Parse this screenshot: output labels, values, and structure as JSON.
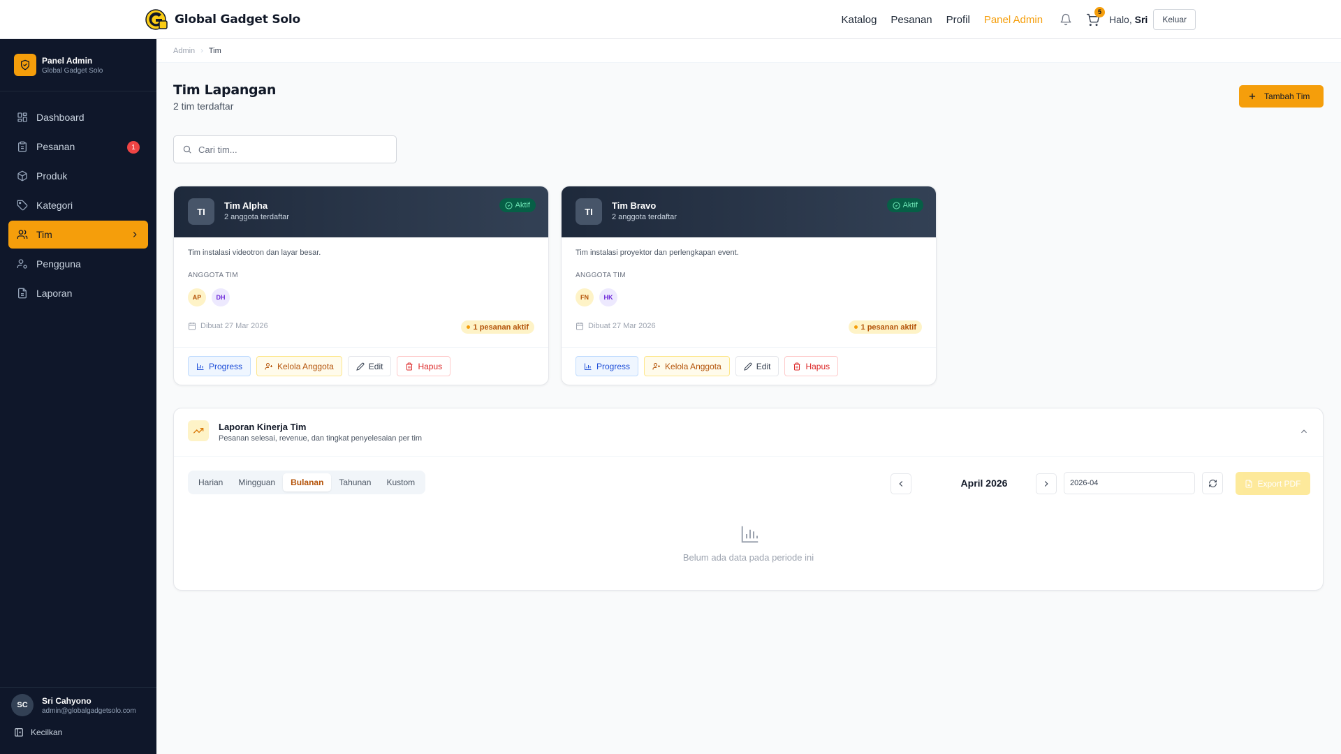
{
  "app": {
    "name": "Global Gadget Solo",
    "accent": "#f59e0b"
  },
  "topnav": {
    "links": [
      "Katalog",
      "Pesanan",
      "Profil",
      "Panel Admin"
    ],
    "active": "Panel Admin",
    "cart_count": "5",
    "greeting_prefix": "Halo,",
    "user_first_name": "Sri",
    "logout_label": "Keluar"
  },
  "sidebar": {
    "title": "Panel Admin",
    "subtitle": "Global Gadget Solo",
    "items": [
      {
        "label": "Dashboard",
        "icon": "grid-icon"
      },
      {
        "label": "Pesanan",
        "icon": "clipboard-icon",
        "count": "1"
      },
      {
        "label": "Produk",
        "icon": "box-icon"
      },
      {
        "label": "Kategori",
        "icon": "tag-icon"
      },
      {
        "label": "Tim",
        "icon": "users-icon",
        "active": true
      },
      {
        "label": "Pengguna",
        "icon": "user-cog-icon"
      },
      {
        "label": "Laporan",
        "icon": "file-icon"
      }
    ],
    "user": {
      "initials": "SC",
      "name": "Sri Cahyono",
      "email": "admin@globalgadgetsolo.com"
    },
    "collapse_label": "Kecilkan"
  },
  "breadcrumb": {
    "root": "Admin",
    "current": "Tim"
  },
  "page": {
    "title": "Tim Lapangan",
    "subtitle": "2 tim terdaftar",
    "add_button": "Tambah Tim",
    "search_placeholder": "Cari tim..."
  },
  "teams": [
    {
      "initials": "TI",
      "name": "Tim Alpha",
      "member_count": "2 anggota terdaftar",
      "status": "Aktif",
      "description": "Tim instalasi videotron dan layar besar.",
      "members_label": "ANGGOTA TIM",
      "members": [
        {
          "initials": "AP",
          "bg": "#fef3c7",
          "fg": "#b45309"
        },
        {
          "initials": "DH",
          "bg": "#ede9fe",
          "fg": "#6d28d9"
        }
      ],
      "created": "Dibuat 27 Mar 2026",
      "active_orders": "1 pesanan aktif",
      "actions": {
        "progress": "Progress",
        "manage": "Kelola Anggota",
        "edit": "Edit",
        "delete": "Hapus"
      }
    },
    {
      "initials": "TI",
      "name": "Tim Bravo",
      "member_count": "2 anggota terdaftar",
      "status": "Aktif",
      "description": "Tim instalasi proyektor dan perlengkapan event.",
      "members_label": "ANGGOTA TIM",
      "members": [
        {
          "initials": "FN",
          "bg": "#fef3c7",
          "fg": "#b45309"
        },
        {
          "initials": "HK",
          "bg": "#ede9fe",
          "fg": "#6d28d9"
        }
      ],
      "created": "Dibuat 27 Mar 2026",
      "active_orders": "1 pesanan aktif",
      "actions": {
        "progress": "Progress",
        "manage": "Kelola Anggota",
        "edit": "Edit",
        "delete": "Hapus"
      }
    }
  ],
  "report": {
    "title": "Laporan Kinerja Tim",
    "subtitle": "Pesanan selesai, revenue, dan tingkat penyelesaian per tim",
    "tabs": [
      "Harian",
      "Mingguan",
      "Bulanan",
      "Tahunan",
      "Kustom"
    ],
    "active_tab": "Bulanan",
    "period_label": "April 2026",
    "month_value": "2026-04",
    "export_label": "Export PDF",
    "empty_text": "Belum ada data pada periode ini"
  }
}
